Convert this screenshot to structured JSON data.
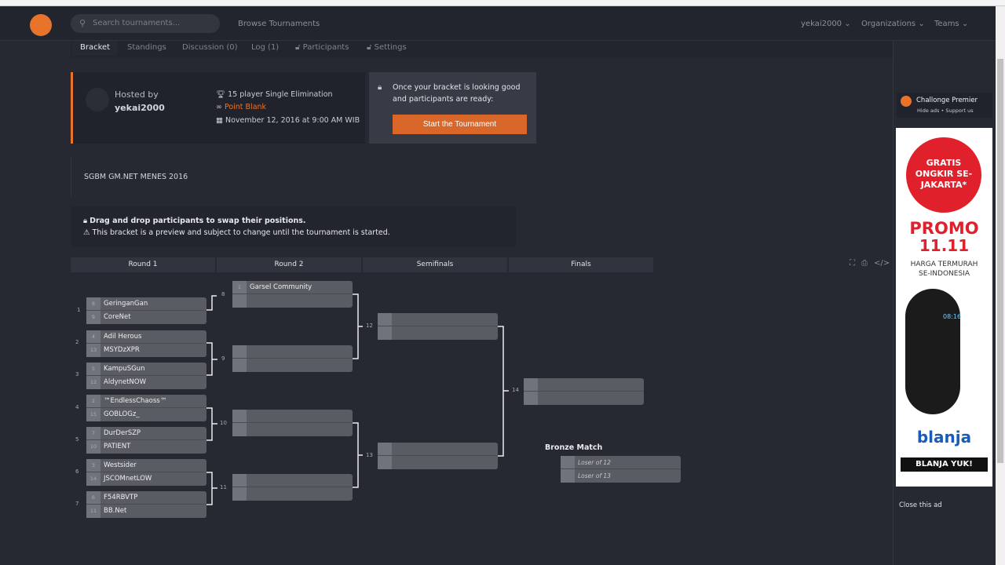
{
  "nav": {
    "search_placeholder": "Search tournaments...",
    "browse": "Browse Tournaments",
    "user": "yekai2000 ⌄",
    "organizations": "Organizations ⌄",
    "teams": "Teams ⌄"
  },
  "tabs": [
    "Bracket",
    "Standings",
    "Discussion (0)",
    "Log (1)",
    "Participants",
    "Settings"
  ],
  "info": {
    "hosted_by_label": "Hosted by",
    "host": "yekai2000",
    "format": "15 player Single Elimination",
    "game": "Point Blank",
    "date": "November 12, 2016 at 9:00 AM WIB"
  },
  "start": {
    "message": "Once your bracket is looking good and participants are ready:",
    "button": "Start the Tournament"
  },
  "description": "SGBM GM.NET MENES 2016",
  "notice": {
    "line1": "Drag and drop participants to swap their positions.",
    "line2": "This bracket is a preview and subject to change until the tournament is started."
  },
  "rounds": [
    "Round 1",
    "Round 2",
    "Semifinals",
    "Finals"
  ],
  "matches": [
    {
      "id": "1",
      "players": [
        [
          "8",
          "GeringanGan"
        ],
        [
          "9",
          "CoreNet"
        ]
      ]
    },
    {
      "id": "2",
      "players": [
        [
          "4",
          "Adil Herous"
        ],
        [
          "13",
          "MSYDzXPR"
        ]
      ]
    },
    {
      "id": "3",
      "players": [
        [
          "5",
          "KampuSGun"
        ],
        [
          "12",
          "AldynetNOW"
        ]
      ]
    },
    {
      "id": "4",
      "players": [
        [
          "2",
          "™EndlessChaoss™"
        ],
        [
          "15",
          "GOBLOGz_"
        ]
      ]
    },
    {
      "id": "5",
      "players": [
        [
          "7",
          "DurDerSZP"
        ],
        [
          "10",
          "PATIENT"
        ]
      ]
    },
    {
      "id": "6",
      "players": [
        [
          "3",
          "Westsider"
        ],
        [
          "14",
          "JSCOMnetLOW"
        ]
      ]
    },
    {
      "id": "7",
      "players": [
        [
          "6",
          "F54RBVTP"
        ],
        [
          "11",
          "BB.Net"
        ]
      ]
    },
    {
      "id": "8",
      "players": [
        [
          "1",
          "Garsel Community"
        ],
        [
          "",
          ""
        ]
      ]
    },
    {
      "id": "9",
      "players": [
        [
          "",
          ""
        ],
        [
          "",
          ""
        ]
      ]
    },
    {
      "id": "10",
      "players": [
        [
          "",
          ""
        ],
        [
          "",
          ""
        ]
      ]
    },
    {
      "id": "11",
      "players": [
        [
          "",
          ""
        ],
        [
          "",
          ""
        ]
      ]
    },
    {
      "id": "12",
      "players": [
        [
          "",
          ""
        ],
        [
          "",
          ""
        ]
      ]
    },
    {
      "id": "13",
      "players": [
        [
          "",
          ""
        ],
        [
          "",
          ""
        ]
      ]
    },
    {
      "id": "14",
      "players": [
        [
          "",
          ""
        ],
        [
          "",
          ""
        ]
      ]
    }
  ],
  "bronze": {
    "title": "Bronze Match",
    "players": [
      "Loser of 12",
      "Loser of 13"
    ]
  },
  "sidebar": {
    "premier_title": "Challonge Premier",
    "premier_sub": "Hide ads • Support us",
    "close_ad": "Close this ad"
  },
  "ad": {
    "badge": "GRATIS ONGKIR SE-JAKARTA*",
    "promo": "PROMO",
    "promo_date": "11.11",
    "tagline": "HARGA TERMURAH SE-INDONESIA",
    "watch_time": "08:16",
    "brand": "blanja",
    "cta": "BLANJA YUK!"
  },
  "colors": {
    "accent": "#e8742c",
    "background": "#262932",
    "match": "#5a5c63"
  }
}
